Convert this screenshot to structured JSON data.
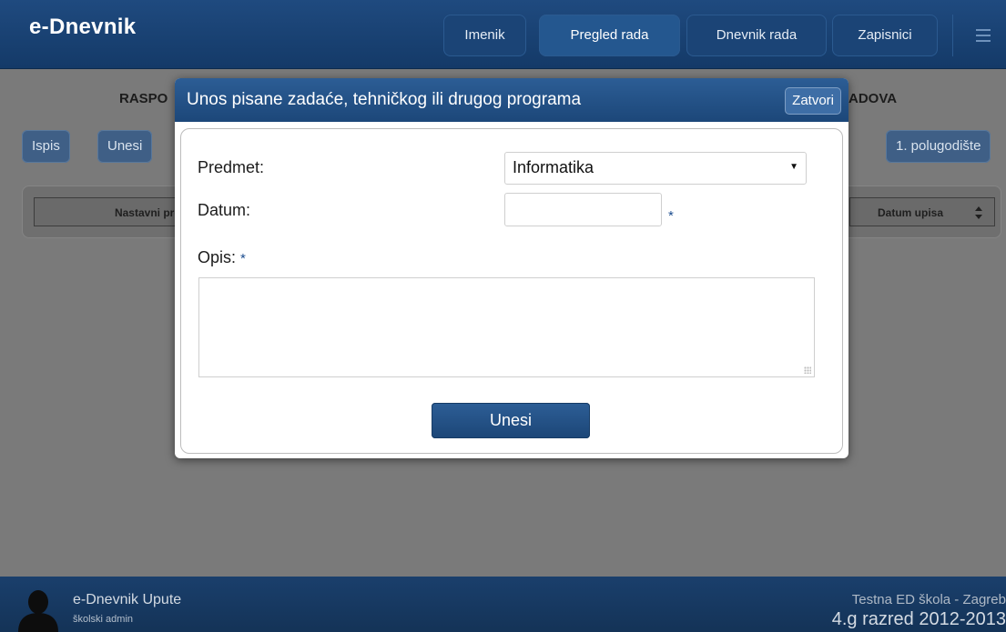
{
  "app": {
    "title": "e-Dnevnik"
  },
  "nav": {
    "items": [
      {
        "label": "Imenik"
      },
      {
        "label": "Pregled rada"
      },
      {
        "label": "Dnevnik rada"
      },
      {
        "label": "Zapisnici"
      }
    ],
    "menu_icon": "menu-icon"
  },
  "page": {
    "title_left": "RASPO",
    "title_right": "ADOVA",
    "buttons": {
      "print": "Ispis",
      "add": "Unesi",
      "semester": "1. polugodište"
    },
    "table_headers": {
      "subject": "Nastavni pre",
      "entry_date": "Datum upisa"
    },
    "sort_icon": "sort-updown-icon"
  },
  "modal": {
    "title": "Unos pisane zadaće, tehničkog ili drugog programa",
    "close_label": "Zatvori",
    "fields": {
      "subject_label": "Predmet:",
      "subject_value": "Informatika",
      "date_label": "Datum:",
      "date_value": "",
      "description_label": "Opis:",
      "description_value": "",
      "required_mark": "*"
    },
    "submit_label": "Unesi"
  },
  "footer": {
    "help_link": "e-Dnevnik Upute",
    "user_role": "školski admin",
    "school": "Testna ED škola - Zagreb",
    "class_year": "4.g razred 2012-2013",
    "avatar_icon": "user-silhouette-icon"
  },
  "colors": {
    "header_blue": "#1f4a7f",
    "footer_blue": "#1a3f6c",
    "overlay_grey": "#7a7a7a",
    "required_star": "#1c4d8f"
  }
}
